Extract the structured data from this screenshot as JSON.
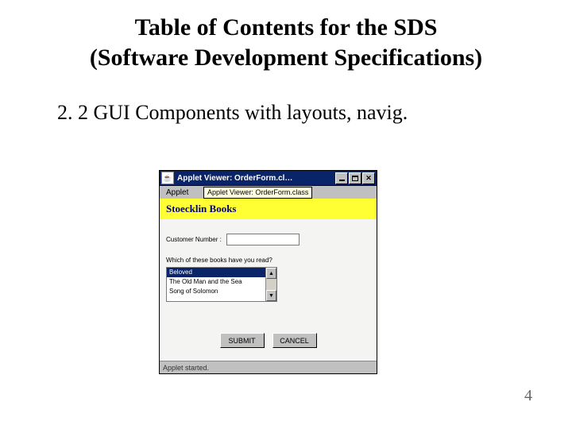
{
  "slide": {
    "title_line1": "Table of Contents for the SDS",
    "title_line2": "(Software Development Specifications)",
    "section": "2. 2 GUI Components  with layouts, navig.",
    "page_number": "4"
  },
  "applet": {
    "sysicon_glyph": "☕",
    "title": "Applet Viewer: OrderForm.cl…",
    "menu": {
      "item0": "Applet"
    },
    "tooltip": "Applet Viewer: OrderForm.class",
    "banner": "Stoecklin Books",
    "customer_label": "Customer Number :",
    "prompt": "Which of these books have you read?",
    "list": {
      "items": [
        "Beloved",
        "The Old Man and the Sea",
        "Song of Solomon"
      ],
      "scroll_up_glyph": "▲",
      "scroll_down_glyph": "▼"
    },
    "buttons": {
      "submit": "SUBMIT",
      "cancel": "CANCEL"
    },
    "close_glyph": "✕",
    "status": "Applet started."
  }
}
